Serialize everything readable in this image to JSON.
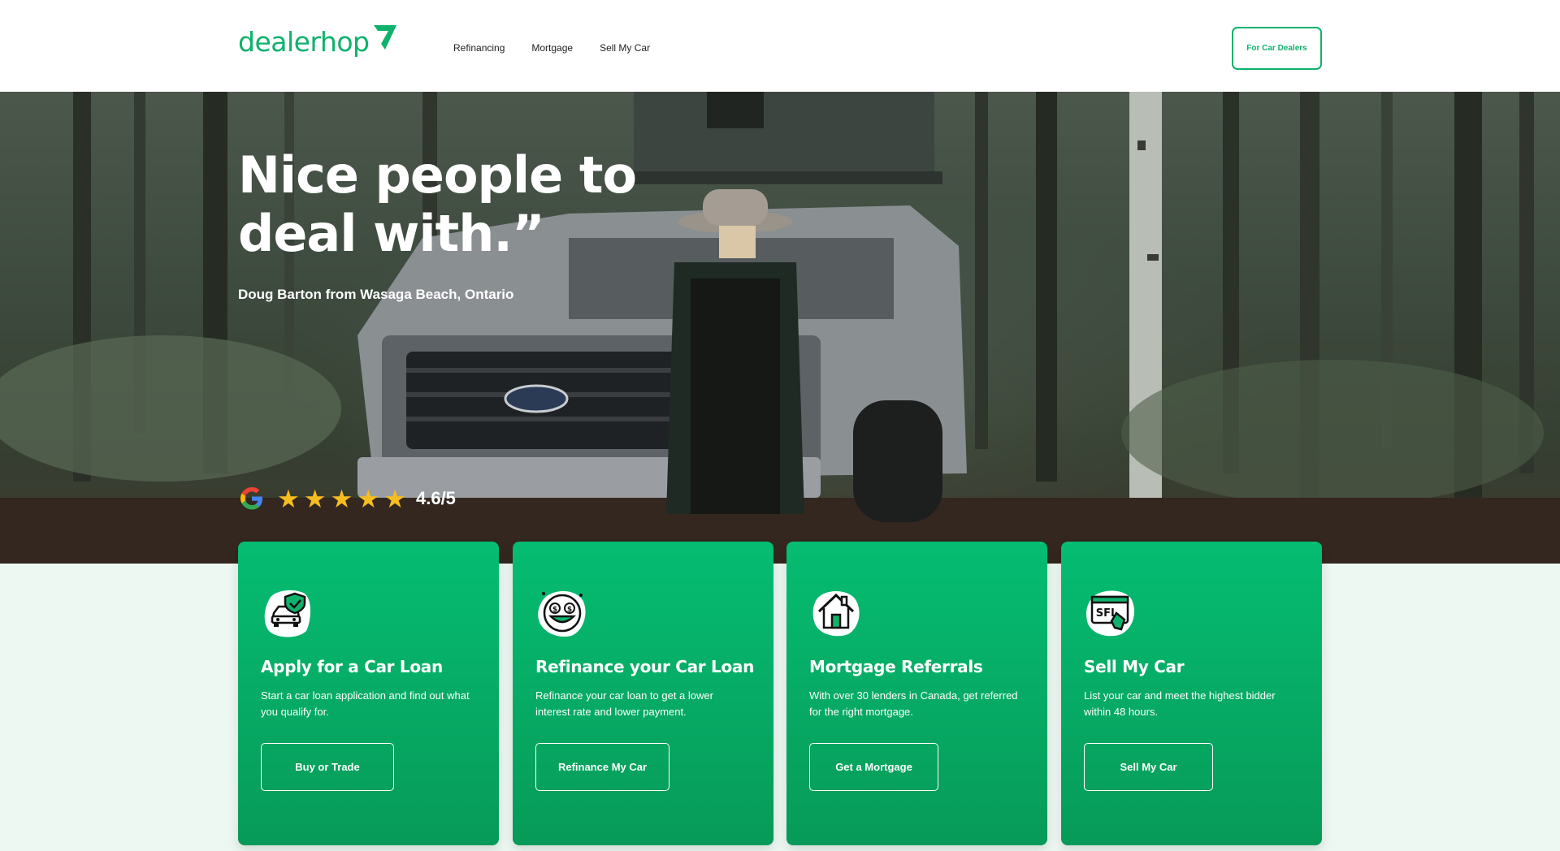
{
  "brand": {
    "logo_text": "dealerhop",
    "accent": "#0fb26c",
    "card_top": "#05bd72",
    "card_bottom": "#079a58"
  },
  "nav": {
    "items": [
      {
        "label": "Refinancing"
      },
      {
        "label": "Mortgage"
      },
      {
        "label": "Sell My Car"
      }
    ],
    "cta_label": "For Car Dealers"
  },
  "hero": {
    "quote": "Nice people to deal with.”",
    "author": "Doug Barton from Wasaga Beach, Ontario",
    "rating": {
      "stars": 5,
      "value": "4.6/5",
      "icon": "google-icon"
    }
  },
  "cards": [
    {
      "icon": "car-shield-icon",
      "title": "Apply for a Car Loan",
      "description": "Start a car loan application and find out what you qualify for.",
      "button": "Buy or Trade"
    },
    {
      "icon": "money-face-icon",
      "title": "Refinance your Car Loan",
      "description": "Refinance your car loan to get a lower interest rate and lower payment.",
      "button": "Refinance My Car"
    },
    {
      "icon": "house-icon",
      "title": "Mortgage Referrals",
      "description": "With over 30 lenders in Canada, get referred for the right mortgage.",
      "button": "Get a Mortgage"
    },
    {
      "icon": "for-sale-sign-icon",
      "title": "Sell My Car",
      "description": "List your car and meet the highest bidder within 48 hours.",
      "button": "Sell My Car"
    }
  ]
}
